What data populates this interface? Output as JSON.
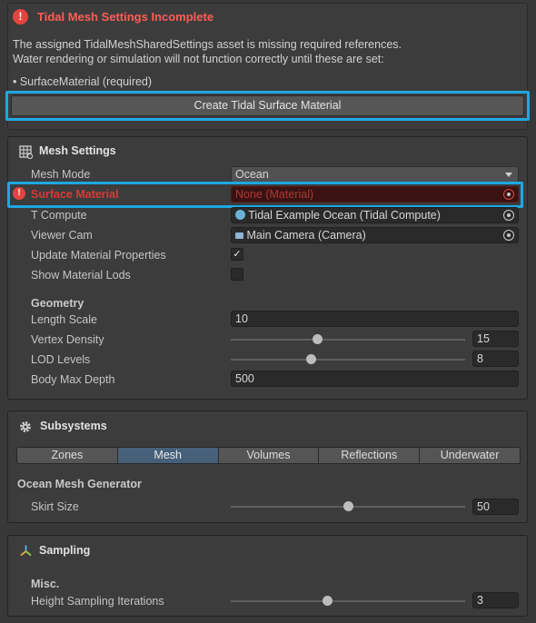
{
  "warning": {
    "title": "Tidal Mesh Settings Incomplete",
    "line1": "The assigned TidalMeshSharedSettings asset is missing required references.",
    "line2": "Water rendering or simulation will not function correctly until these are set:",
    "bullet": "• SurfaceMaterial (required)",
    "create_button": "Create Tidal Surface Material"
  },
  "mesh_settings": {
    "title": "Mesh Settings",
    "mesh_mode": {
      "label": "Mesh Mode",
      "value": "Ocean"
    },
    "surface_material": {
      "label": "Surface Material",
      "value": "None (Material)"
    },
    "t_compute": {
      "label": "T Compute",
      "value": "Tidal Example Ocean (Tidal Compute)"
    },
    "viewer_cam": {
      "label": "Viewer Cam",
      "value": "Main Camera (Camera)"
    },
    "update_material": {
      "label": "Update Material Properties",
      "checked": true
    },
    "show_lods": {
      "label": "Show Material Lods",
      "checked": false
    },
    "geometry": {
      "title": "Geometry",
      "length_scale": {
        "label": "Length Scale",
        "value": "10"
      },
      "vertex_density": {
        "label": "Vertex Density",
        "value": "15",
        "fraction": 0.37
      },
      "lod_levels": {
        "label": "LOD Levels",
        "value": "8",
        "fraction": 0.34
      },
      "body_max_depth": {
        "label": "Body Max Depth",
        "value": "500"
      }
    }
  },
  "subsystems": {
    "title": "Subsystems",
    "tabs": [
      "Zones",
      "Mesh",
      "Volumes",
      "Reflections",
      "Underwater"
    ],
    "active_tab": "Mesh",
    "generator_title": "Ocean Mesh Generator",
    "skirt_size": {
      "label": "Skirt Size",
      "value": "50",
      "fraction": 0.5
    }
  },
  "sampling": {
    "title": "Sampling",
    "misc_title": "Misc.",
    "height_iterations": {
      "label": "Height Sampling Iterations",
      "value": "3",
      "fraction": 0.41
    }
  },
  "colors": {
    "error_red": "#ff5d55",
    "highlight_blue": "#1ea7e2",
    "active_tab": "#46607a"
  }
}
